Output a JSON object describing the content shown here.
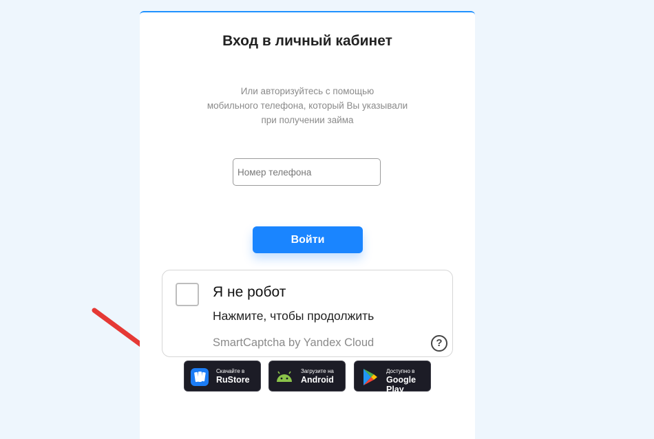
{
  "login": {
    "title": "Вход в личный кабинет",
    "subtitle_lines": [
      "Или авторизуйтесь с помощью",
      "мобильного телефона, который Вы указывали",
      "при получении займа"
    ],
    "phone_placeholder": "Номер телефона",
    "phone_value": "",
    "submit_label": "Войти"
  },
  "captcha": {
    "checked": false,
    "title": "Я не робот",
    "hint": "Нажмите, чтобы продолжить",
    "brand": "SmartCaptcha by Yandex Cloud",
    "help_symbol": "?"
  },
  "stores": [
    {
      "small": "Скачайте в",
      "big": "RuStore",
      "icon": "rustore-icon"
    },
    {
      "small": "Загрузите на",
      "big": "Android",
      "icon": "android-icon"
    },
    {
      "small": "Доступно в",
      "big": "Google Play",
      "icon": "google-play-icon"
    }
  ],
  "colors": {
    "accent": "#1a85ff",
    "page_background": "#eef6fd",
    "badge_background": "#1c1c26",
    "annotation_arrow": "#e53935"
  }
}
